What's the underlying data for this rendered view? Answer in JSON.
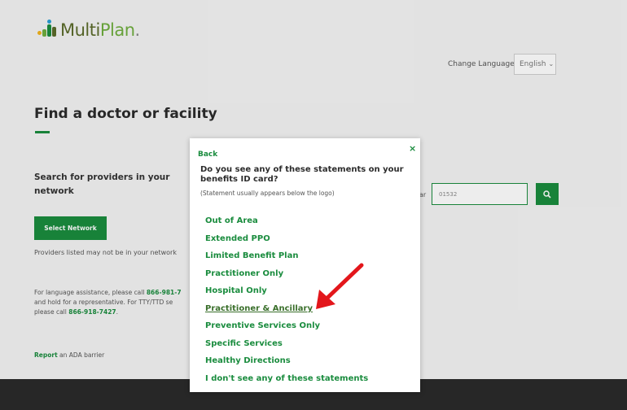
{
  "header": {
    "logo_prefix": "Multi",
    "logo_suffix": "Plan",
    "logo_dot": ".",
    "change_language_label": "Change Language",
    "language_value": "English",
    "logo_icon": "multiplan-mark-icon",
    "caret_icon": "chevron-down-icon"
  },
  "main": {
    "page_title": "Find a doctor or facility",
    "search_heading": "Search for providers in your network",
    "select_network_label": "Select Network",
    "providers_note": "Providers listed may not be in your network",
    "assist_line1_prefix": "For language assistance, please call ",
    "assist_phone1": "866-981-7",
    "assist_line2": "and hold for a representative. For TTY/TTD se",
    "assist_line3_prefix": "please call ",
    "assist_phone2": "866-918-7427",
    "assist_line3_suffix": ".",
    "ada_link": "Report",
    "ada_text": " an ADA barrier",
    "zip_label_fragment": "ar",
    "zip_value": "01532",
    "search_icon": "search-icon"
  },
  "modal": {
    "back_label": "Back",
    "close_label": "×",
    "question": "Do you see any of these statements on your benefits ID card?",
    "hint": "(Statement usually appears below the logo)",
    "options": [
      "Out of Area",
      "Extended PPO",
      "Limited Benefit Plan",
      "Practitioner Only",
      "Hospital Only",
      "Practitioner & Ancillary",
      "Preventive Services Only",
      "Specific Services",
      "Healthy Directions",
      "I don't see any of these statements"
    ],
    "highlighted_option": "Practitioner & Ancillary",
    "annotation_icon": "red-arrow-icon"
  },
  "colors": {
    "brand_green": "#1a8c3e",
    "arrow_red": "#e3161b",
    "footer_dark": "#2a2a2a"
  }
}
